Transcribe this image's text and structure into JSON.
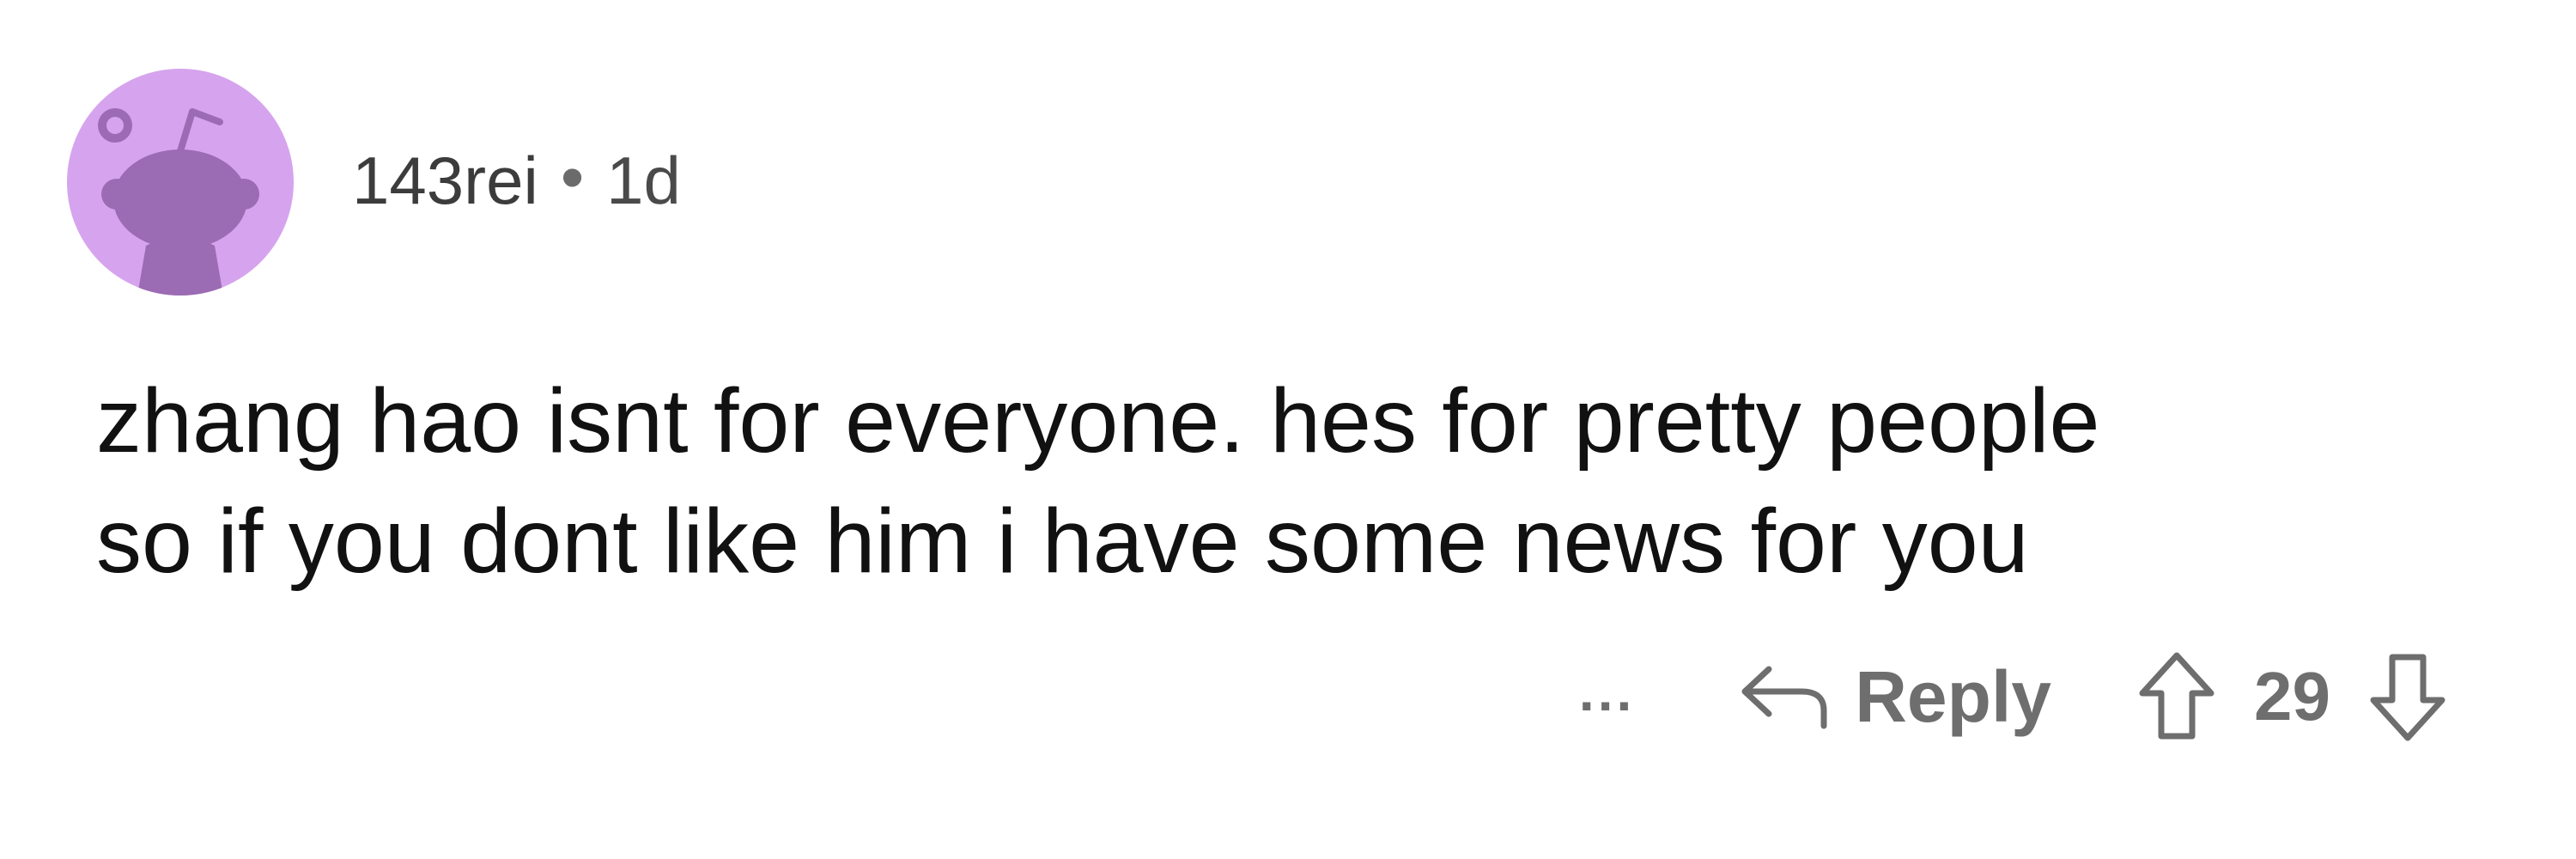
{
  "comment": {
    "username": "143rei",
    "separator": "•",
    "age": "1d",
    "text_lines": [
      "zhang hao isnt for everyone. hes for pretty people",
      "so if you dont like him i have some news for you"
    ],
    "avatar_icon": "reddit-snoo-avatar-icon",
    "avatar_background": "#d6a4ee",
    "avatar_figure_color": "#9b6bb3"
  },
  "actions": {
    "more_label": "...",
    "reply_label": "Reply",
    "reply_icon": "reply-arrow-icon",
    "upvote_icon": "upvote-arrow-icon",
    "downvote_icon": "downvote-arrow-icon",
    "vote_count": "29"
  }
}
